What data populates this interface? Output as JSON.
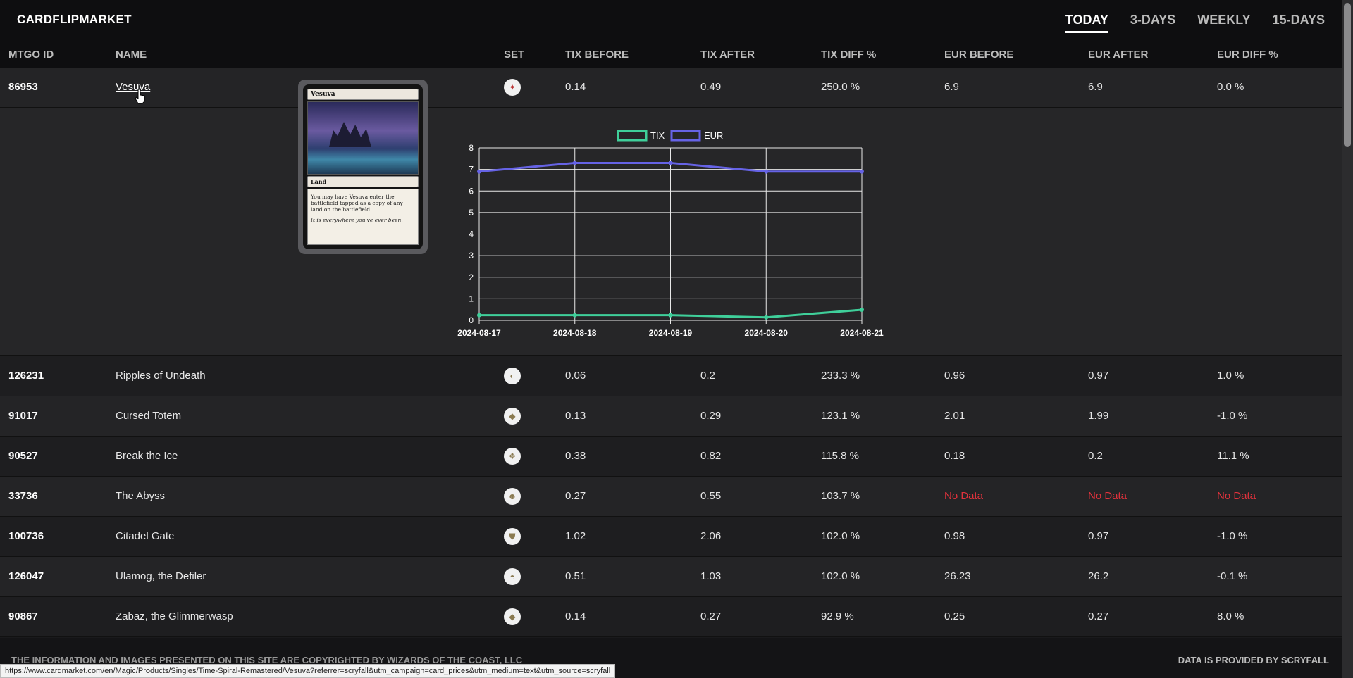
{
  "brand": "CARDFLIPMARKET",
  "periods": [
    {
      "label": "TODAY",
      "active": true
    },
    {
      "label": "3-DAYS",
      "active": false
    },
    {
      "label": "WEEKLY",
      "active": false
    },
    {
      "label": "15-DAYS",
      "active": false
    }
  ],
  "columns": [
    "MTGO ID",
    "NAME",
    "SET",
    "TIX BEFORE",
    "TIX AFTER",
    "TIX DIFF %",
    "EUR BEFORE",
    "EUR AFTER",
    "EUR DIFF %"
  ],
  "first_row": {
    "id": "86953",
    "name": "Vesuva",
    "tix_before": "0.14",
    "tix_after": "0.49",
    "tix_diff": "250.0 %",
    "eur_before": "6.9",
    "eur_after": "6.9",
    "eur_diff": "0.0 %"
  },
  "card_preview": {
    "title": "Vesuva",
    "type_line": "Land",
    "rules_text": "You may have Vesuva enter the battlefield tapped as a copy of any land on the battlefield.",
    "flavor_text": "It is everywhere you've ever been."
  },
  "chart_data": {
    "type": "line",
    "x": [
      "2024-08-17",
      "2024-08-18",
      "2024-08-19",
      "2024-08-20",
      "2024-08-21"
    ],
    "series": [
      {
        "name": "TIX",
        "values": [
          0.24,
          0.24,
          0.24,
          0.14,
          0.49
        ],
        "color": "#3fcf9a"
      },
      {
        "name": "EUR",
        "values": [
          6.9,
          7.3,
          7.3,
          6.9,
          6.9
        ],
        "color": "#6663e6"
      }
    ],
    "ylim": [
      0,
      8
    ],
    "yticks": [
      "0",
      "1",
      "2",
      "3",
      "4",
      "5",
      "6",
      "7",
      "8"
    ],
    "grid": true,
    "legend": "top"
  },
  "rows": [
    {
      "id": "126231",
      "name": "Ripples of Undeath",
      "tix_before": "0.06",
      "tix_after": "0.2",
      "tix_diff": "233.3 %",
      "eur_before": "0.96",
      "eur_after": "0.97",
      "eur_diff": "1.0 %"
    },
    {
      "id": "91017",
      "name": "Cursed Totem",
      "tix_before": "0.13",
      "tix_after": "0.29",
      "tix_diff": "123.1 %",
      "eur_before": "2.01",
      "eur_after": "1.99",
      "eur_diff": "-1.0 %"
    },
    {
      "id": "90527",
      "name": "Break the Ice",
      "tix_before": "0.38",
      "tix_after": "0.82",
      "tix_diff": "115.8 %",
      "eur_before": "0.18",
      "eur_after": "0.2",
      "eur_diff": "11.1 %"
    },
    {
      "id": "33736",
      "name": "The Abyss",
      "tix_before": "0.27",
      "tix_after": "0.55",
      "tix_diff": "103.7 %",
      "eur_before": "No Data",
      "eur_after": "No Data",
      "eur_diff": "No Data"
    },
    {
      "id": "100736",
      "name": "Citadel Gate",
      "tix_before": "1.02",
      "tix_after": "2.06",
      "tix_diff": "102.0 %",
      "eur_before": "0.98",
      "eur_after": "0.97",
      "eur_diff": "-1.0 %"
    },
    {
      "id": "126047",
      "name": "Ulamog, the Defiler",
      "tix_before": "0.51",
      "tix_after": "1.03",
      "tix_diff": "102.0 %",
      "eur_before": "26.23",
      "eur_after": "26.2",
      "eur_diff": "-0.1 %"
    },
    {
      "id": "90867",
      "name": "Zabaz, the Glimmerwasp",
      "tix_before": "0.14",
      "tix_after": "0.27",
      "tix_diff": "92.9 %",
      "eur_before": "0.25",
      "eur_after": "0.27",
      "eur_diff": "8.0 %"
    }
  ],
  "footer": {
    "left": "THE INFORMATION AND IMAGES PRESENTED ON THIS SITE ARE COPYRIGHTED BY WIZARDS OF THE COAST, LLC",
    "right": "DATA IS PROVIDED BY SCRYFALL"
  },
  "status_url": "https://www.cardmarket.com/en/Magic/Products/Singles/Time-Spiral-Remastered/Vesuva?referrer=scryfall&utm_campaign=card_prices&utm_medium=text&utm_source=scryfall",
  "colors": {
    "no_data": "#e0323c",
    "tix": "#3fcf9a",
    "eur": "#6663e6"
  }
}
